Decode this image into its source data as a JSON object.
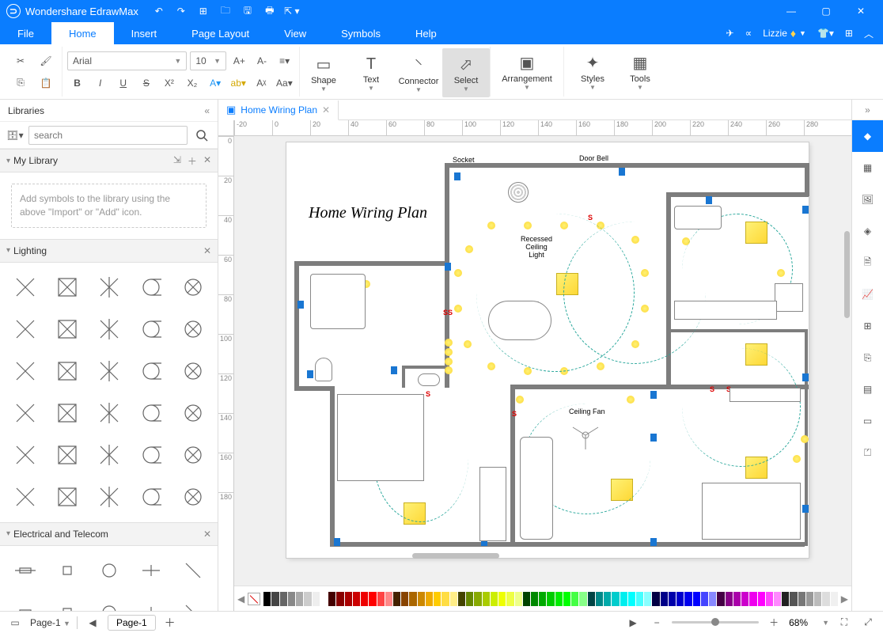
{
  "app": {
    "title": "Wondershare EdrawMax"
  },
  "quick_access": [
    "undo",
    "redo",
    "new",
    "open",
    "save",
    "print",
    "export"
  ],
  "window_controls": [
    "minimize",
    "maximize",
    "close"
  ],
  "menu": {
    "items": [
      "File",
      "Home",
      "Insert",
      "Page Layout",
      "View",
      "Symbols",
      "Help"
    ],
    "active": "Home"
  },
  "top_right": {
    "user": "Lizzie",
    "icons": [
      "send",
      "share",
      "shirt",
      "apps",
      "collapse"
    ]
  },
  "ribbon": {
    "clipboard": [
      "cut",
      "format-painter",
      "copy",
      "paste"
    ],
    "font": {
      "name": "Arial",
      "size": "10",
      "buttons": [
        "bold",
        "italic",
        "underline",
        "strikethrough",
        "superscript",
        "subscript",
        "font-color",
        "highlight"
      ],
      "top_buttons": [
        "increase-font",
        "decrease-font",
        "align"
      ]
    },
    "paragraph": [
      "bullets",
      "align-left",
      "spacing-small",
      "spacing-big",
      "clear"
    ],
    "tools": [
      {
        "name": "shape",
        "label": "Shape",
        "dropdown": true
      },
      {
        "name": "text",
        "label": "Text",
        "dropdown": true
      },
      {
        "name": "connector",
        "label": "Connector",
        "dropdown": true
      },
      {
        "name": "select",
        "label": "Select",
        "dropdown": true,
        "selected": true
      },
      {
        "name": "arrangement",
        "label": "Arrangement",
        "dropdown": true
      },
      {
        "name": "styles",
        "label": "Styles",
        "dropdown": true
      },
      {
        "name": "tools",
        "label": "Tools",
        "dropdown": true
      }
    ]
  },
  "libraries": {
    "title": "Libraries",
    "search_placeholder": "search",
    "sections": [
      {
        "name": "My Library",
        "empty_text": "Add symbols to the library using the above \"Import\" or \"Add\" icon."
      },
      {
        "name": "Lighting"
      },
      {
        "name": "Electrical and Telecom"
      }
    ]
  },
  "document": {
    "tab": "Home Wiring Plan",
    "title": "Home Wiring Plan"
  },
  "drawing_labels": {
    "socket": "Socket",
    "doorbell": "Door Bell",
    "recessed": "Recessed\nCeiling\nLight",
    "light": "Light",
    "ceilingfan": "Ceiling Fan"
  },
  "ruler_h": [
    -20,
    0,
    20,
    40,
    60,
    80,
    100,
    120,
    140,
    160,
    180,
    200,
    220,
    240,
    260,
    280
  ],
  "ruler_v": [
    0,
    20,
    40,
    60,
    80,
    100,
    120,
    140,
    160,
    180
  ],
  "swatches": [
    "#000",
    "#444",
    "#666",
    "#888",
    "#aaa",
    "#ccc",
    "#eee",
    "#fff",
    "#400",
    "#800",
    "#a00",
    "#c00",
    "#e00",
    "#f00",
    "#f44",
    "#f88",
    "#420",
    "#840",
    "#a60",
    "#c80",
    "#ea0",
    "#fc0",
    "#fd4",
    "#fe8",
    "#440",
    "#680",
    "#8a0",
    "#ac0",
    "#ce0",
    "#ef0",
    "#ef4",
    "#ef8",
    "#040",
    "#080",
    "#0a0",
    "#0c0",
    "#0e0",
    "#0f0",
    "#4f4",
    "#8f8",
    "#044",
    "#088",
    "#0aa",
    "#0cc",
    "#0ee",
    "#0ff",
    "#4ff",
    "#8ff",
    "#004",
    "#008",
    "#00a",
    "#00c",
    "#00e",
    "#00f",
    "#44f",
    "#88f",
    "#404",
    "#808",
    "#a0a",
    "#c0c",
    "#e0e",
    "#f0f",
    "#f4f",
    "#f8f",
    "#222",
    "#555",
    "#777",
    "#999",
    "#bbb",
    "#ddd",
    "#f0f0f0"
  ],
  "status": {
    "page_selector": "Page-1",
    "page_tab": "Page-1",
    "zoom": "68%"
  },
  "right_tools": [
    "theme",
    "grid",
    "image",
    "layers",
    "page",
    "chart",
    "table",
    "insert",
    "align",
    "slideshow",
    "broadcast"
  ]
}
